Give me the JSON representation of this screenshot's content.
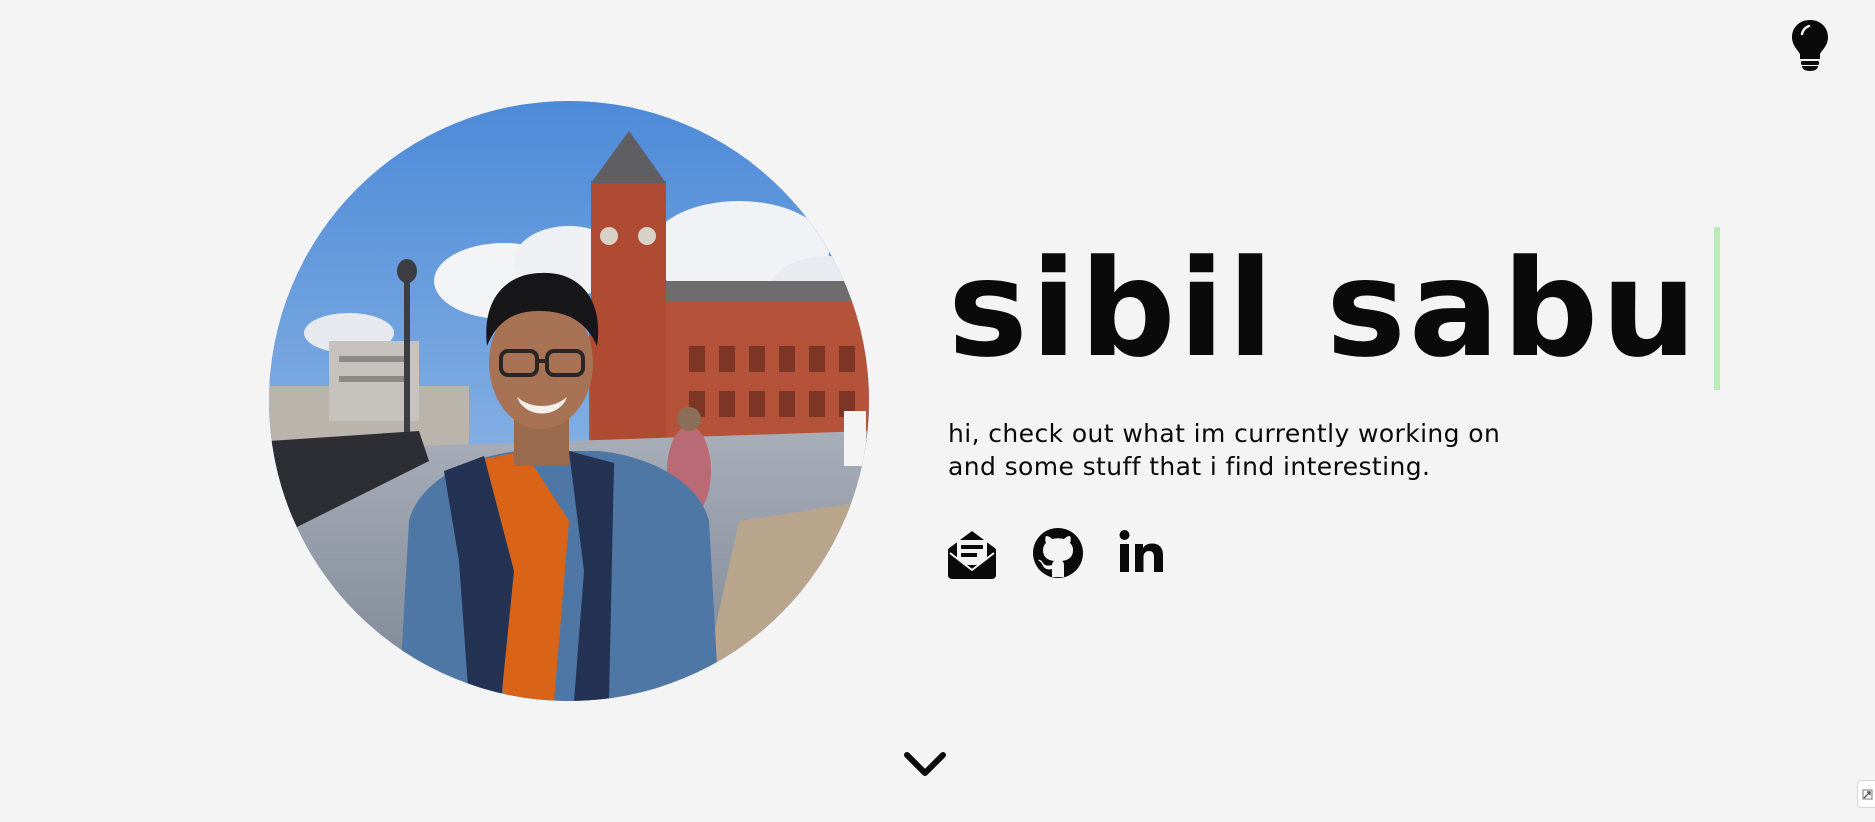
{
  "header": {
    "theme_toggle_icon": "lightbulb-icon"
  },
  "hero": {
    "portrait_icon": "profile-photo",
    "name": "sibil sabu",
    "cursor_color": "#b8ebb5",
    "tagline_lines": [
      "hi, check out what im currently working on",
      "and some stuff that i find interesting."
    ],
    "social_links": [
      {
        "icon": "mail-icon"
      },
      {
        "icon": "github-icon"
      },
      {
        "icon": "linkedin-icon"
      }
    ]
  },
  "footer": {
    "scroll_icon": "chevron-down-icon",
    "corner_icon": "expand-icon"
  },
  "colors": {
    "background": "#f4f4f4",
    "text": "#0a0a0a",
    "accent_cursor": "#b8ebb5"
  }
}
